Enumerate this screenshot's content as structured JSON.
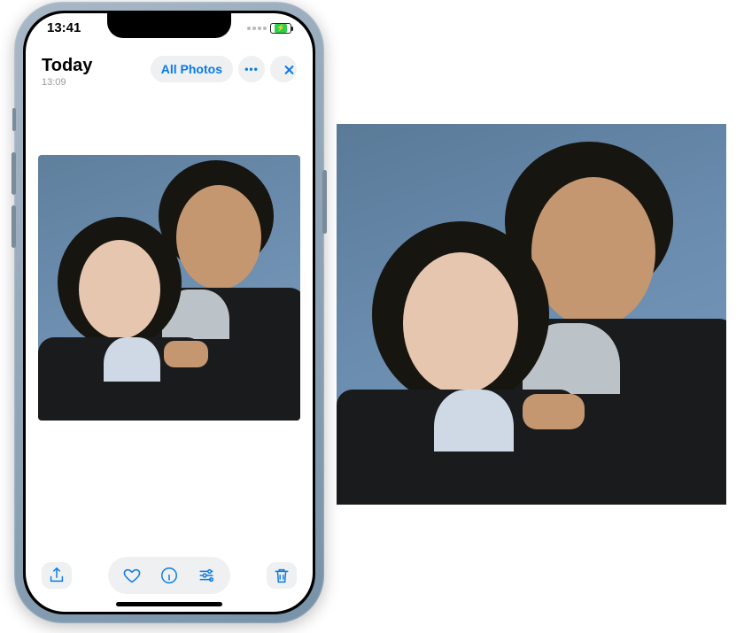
{
  "status": {
    "clock": "13:41"
  },
  "header": {
    "title": "Today",
    "time": "13:09",
    "filter_label": "All Photos"
  },
  "toolbar": {
    "share": "share-icon",
    "heart": "heart-icon",
    "info": "info-icon",
    "edit": "sliders-icon",
    "trash": "trash-icon"
  },
  "colors": {
    "accent": "#0a7be5",
    "muted_bg": "#eef0f2"
  }
}
